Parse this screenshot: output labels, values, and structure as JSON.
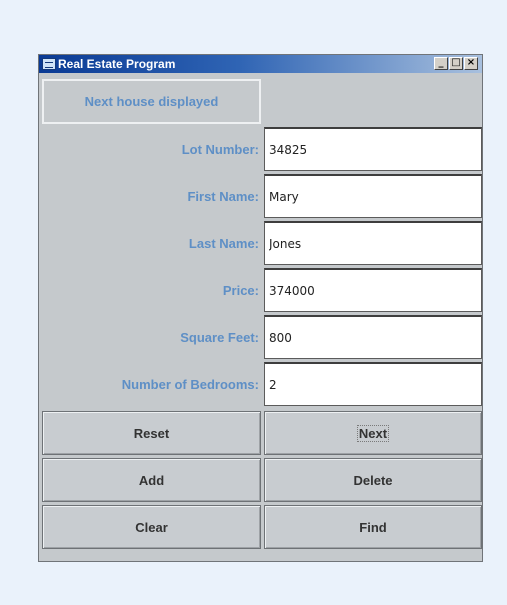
{
  "window": {
    "title": "Real Estate Program",
    "controls": {
      "minimize": "_",
      "maximize": "□",
      "close": "×"
    }
  },
  "status": "Next house displayed",
  "fields": [
    {
      "label": "Lot Number:",
      "value": "34825"
    },
    {
      "label": "First Name:",
      "value": "Mary"
    },
    {
      "label": "Last Name:",
      "value": "Jones"
    },
    {
      "label": "Price:",
      "value": "374000"
    },
    {
      "label": "Square Feet:",
      "value": "800"
    },
    {
      "label": "Number of Bedrooms:",
      "value": "2"
    }
  ],
  "buttons": {
    "reset": "Reset",
    "next": "Next",
    "add": "Add",
    "delete": "Delete",
    "clear": "Clear",
    "find": "Find"
  },
  "colors": {
    "page_background": "#eaf2fb",
    "label_text": "#5e8fc6",
    "title_bar": "#0a3a94"
  }
}
